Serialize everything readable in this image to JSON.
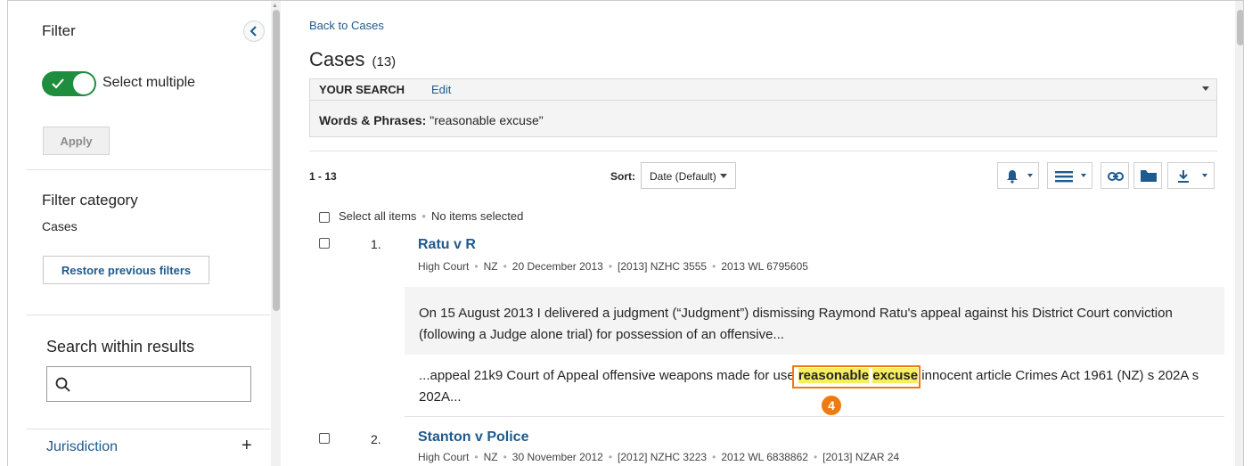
{
  "sidebar": {
    "title": "Filter",
    "toggle_label": "Select multiple",
    "apply_label": "Apply",
    "filter_category_title": "Filter category",
    "filter_category_value": "Cases",
    "restore_label": "Restore previous filters",
    "search_within_title": "Search within results",
    "search_within_value": "",
    "jurisdiction_label": "Jurisdiction",
    "jurisdiction_expand": "+"
  },
  "main": {
    "back_link": "Back to Cases",
    "title": "Cases",
    "count": "(13)",
    "search": {
      "header": "YOUR SEARCH",
      "edit": "Edit",
      "terms_label": "Words & Phrases:",
      "terms_value": "\"reasonable excuse\""
    },
    "range": "1 - 13",
    "sort_label": "Sort:",
    "sort_value": "Date (Default)",
    "select_all": "Select all items",
    "selected_status": "No items selected",
    "results": [
      {
        "number": "1.",
        "title": "Ratu v R",
        "meta": [
          "High Court",
          "NZ",
          "20 December 2013",
          "[2013] NZHC 3555",
          "2013 WL 6795605"
        ],
        "summary": "On 15 August 2013 I delivered a judgment (“Judgment”) dismissing Raymond Ratu's appeal against his District Court conviction (following a Judge alone trial) for possession of an offensive...",
        "snippet_before": "...appeal 21k9 Court of Appeal offensive weapons made for use ",
        "snippet_hl1": "reasonable",
        "snippet_hl2": "excuse",
        "snippet_after": " innocent article Crimes Act 1961 (NZ) s 202A s 202A...",
        "annotation_badge": "4"
      },
      {
        "number": "2.",
        "title": "Stanton v Police",
        "meta": [
          "High Court",
          "NZ",
          "30 November 2012",
          "[2012] NZHC 3223",
          "2012 WL 6838862",
          "[2013] NZAR 24"
        ]
      }
    ]
  },
  "colors": {
    "link": "#1e5a8e",
    "toggle_on": "#1e8e3e",
    "highlight": "#f6ee5e",
    "annotation": "#f07a12"
  }
}
